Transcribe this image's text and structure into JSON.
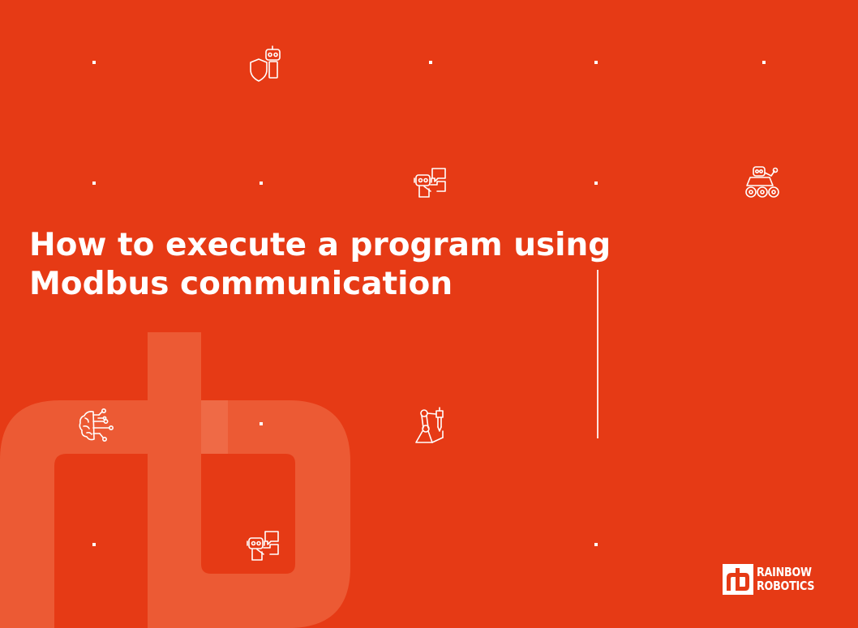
{
  "slide": {
    "title_line1": "How to execute a program using",
    "title_line2": "Modbus communication",
    "background_color": "#E63A15",
    "watermark_color": "#EC5A34",
    "accent_color": "#FFFFFF"
  },
  "brand": {
    "line1": "RAINBOW",
    "line2": "ROBOTICS",
    "symbol": "rb-logo-icon"
  },
  "icons": [
    "robot-shield-icon",
    "robot-chat-icon",
    "robot-rover-icon",
    "ai-brain-icon",
    "robot-arm-icon",
    "robot-chat-icon"
  ]
}
